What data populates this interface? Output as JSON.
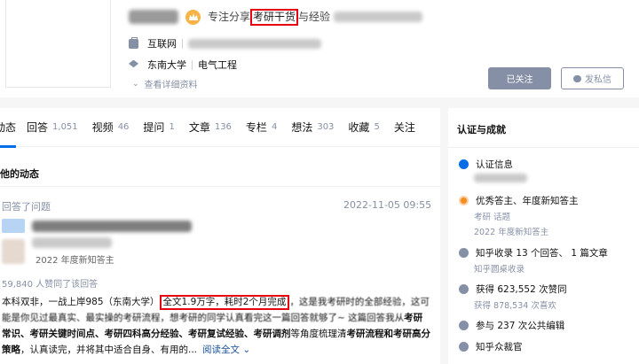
{
  "profile": {
    "headline_pre": "专注分享",
    "headline_hl": "考研干货",
    "headline_post": "与经验",
    "industry": "互联网",
    "school": "东南大学",
    "major": "电气工程",
    "more_link": "查看详细资料",
    "followed_btn": "已关注",
    "message_btn": "发私信"
  },
  "tabs": [
    {
      "label": "动态",
      "count": ""
    },
    {
      "label": "回答",
      "count": "1,051"
    },
    {
      "label": "视频",
      "count": "46"
    },
    {
      "label": "提问",
      "count": "1"
    },
    {
      "label": "文章",
      "count": "136"
    },
    {
      "label": "专栏",
      "count": "4"
    },
    {
      "label": "想法",
      "count": "303"
    },
    {
      "label": "收藏",
      "count": "5"
    },
    {
      "label": "关注",
      "count": ""
    }
  ],
  "feed": {
    "section_title": "他的动态",
    "activity_label": "回答了问题",
    "activity_date": "2022-11-05 09:55",
    "author_tag": "2022 年度新知答主",
    "votes": "59,840 人赞同了该回答",
    "content_pre": "本科双非，一战上岸985（东南大学）",
    "content_hl": "全文1.9万字，耗时2个月完成",
    "content_post": "，这是我考研时的全部经验，这可能是你见过最真实、最实操的考研流程，想考研的同学认真看完这一篇回答就够了~ 这篇回答我从",
    "kw1": "考研常识、考研关键时间点、考研四科高分经验、考研复试经验、考研调剂",
    "content_mid": "等角度梳理清",
    "kw2": "考研流程和考研高分策略",
    "content_end": "，认真读完，并将其中适合自身、有用的...",
    "read_more": "阅读全文 ⌄"
  },
  "sidebar": {
    "title": "认证与成就",
    "verify": "认证信息",
    "honor": "优秀答主、年度新知答主",
    "honor_sub1": "考研 话题",
    "honor_sub2": "2022 年度新知答主",
    "collect": "知乎收录 13 个回答、 1 篇文章",
    "collect_sub": "知乎圆桌收录",
    "likes": "获得 623,552 次赞同",
    "likes_sub": "获得 878,534 次喜欢",
    "edit": "参与 237 次公共编辑",
    "jury": "知乎众裁官"
  },
  "colors": {
    "accent": "#056de8",
    "muted": "#8590a6",
    "highlight_box": "#e60012"
  }
}
